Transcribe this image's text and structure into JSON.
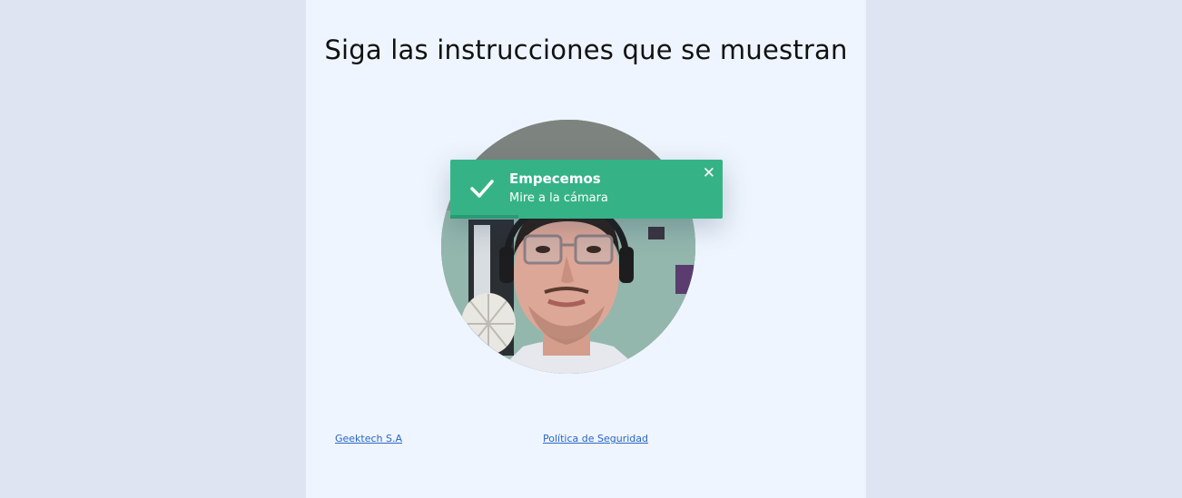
{
  "page": {
    "title": "Siga las instrucciones que se muestran"
  },
  "toast": {
    "title": "Empecemos",
    "message": "Mire a la cámara",
    "close_symbol": "✕",
    "icon": "check-icon",
    "progress": 0.25,
    "color": "#36b386"
  },
  "camera": {
    "icon": "webcam-feed"
  },
  "footer": {
    "company_link": "Geektech S.A",
    "security_link": "Política de Seguridad"
  },
  "colors": {
    "background": "#dfe4f3",
    "panel": "#eef5fe",
    "link": "#2a66c6"
  }
}
